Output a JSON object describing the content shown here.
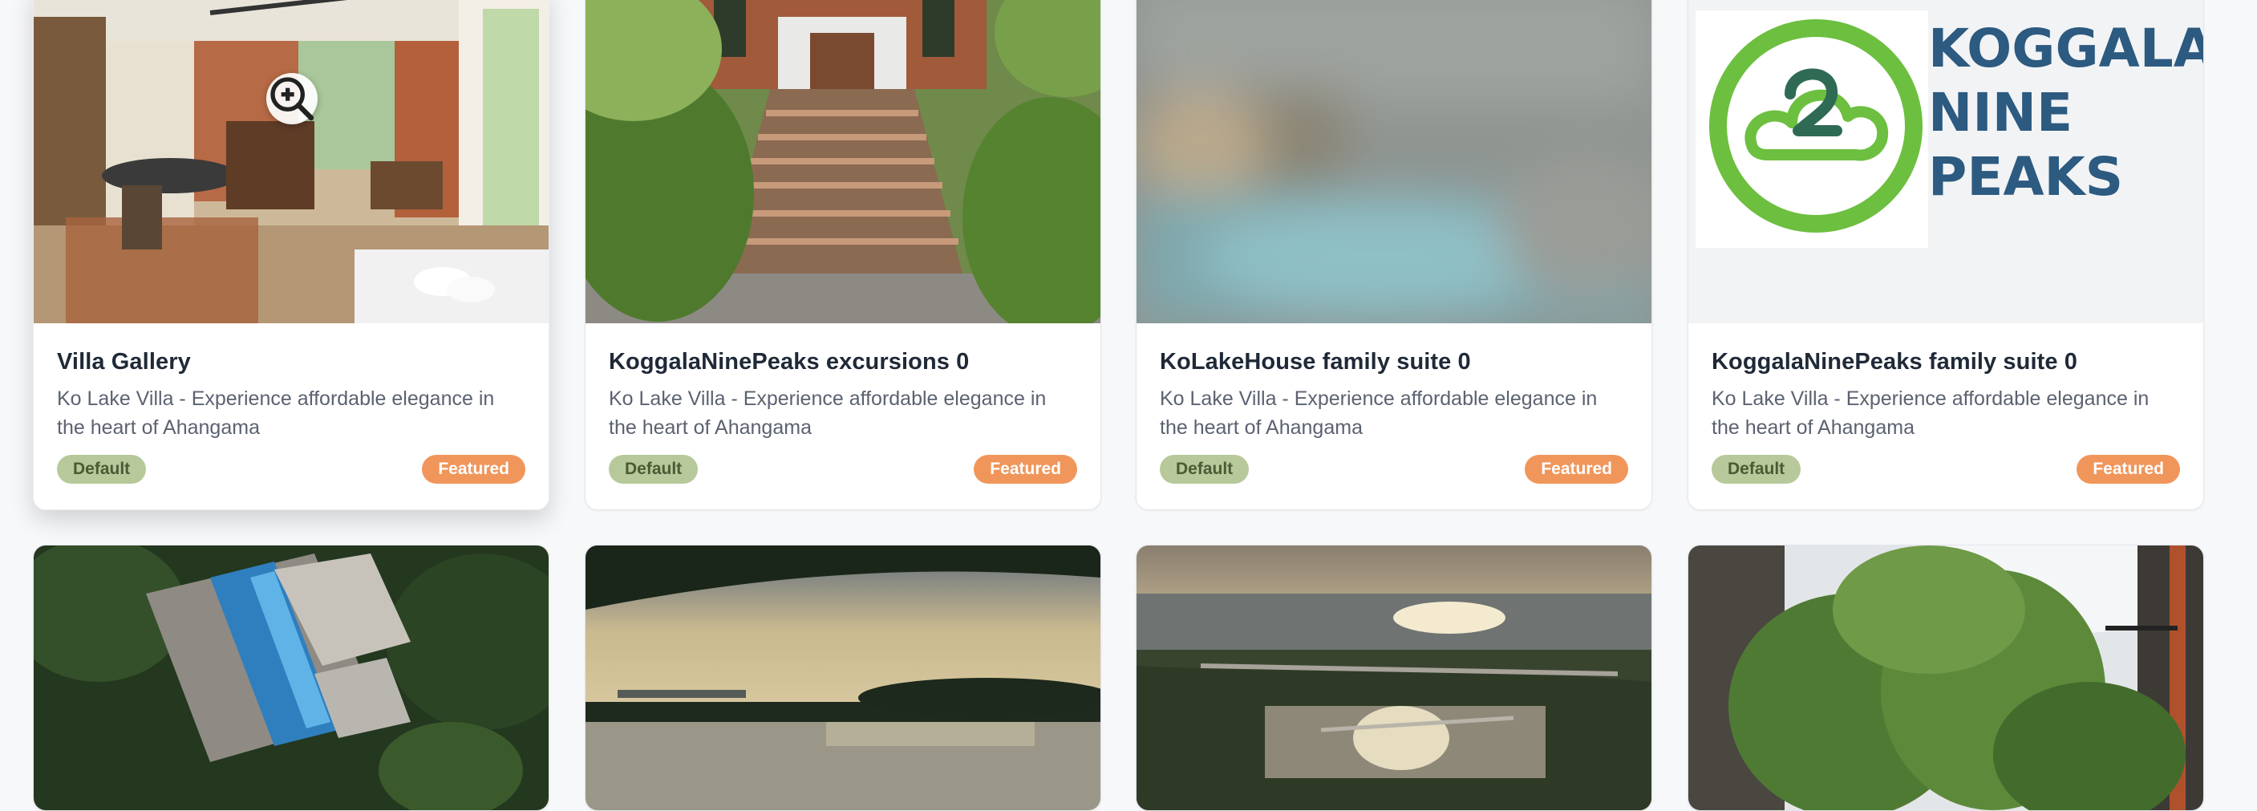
{
  "cards": [
    {
      "title": "Villa Gallery",
      "description": "Ko Lake Villa - Experience affordable elegance in the heart of Ahangama",
      "tag_default": "Default",
      "tag_featured": "Featured"
    },
    {
      "title": "KoggalaNinePeaks excursions 0",
      "description": "Ko Lake Villa - Experience affordable elegance in the heart of Ahangama",
      "tag_default": "Default",
      "tag_featured": "Featured"
    },
    {
      "title": "KoLakeHouse family suite 0",
      "description": "Ko Lake Villa - Experience affordable elegance in the heart of Ahangama",
      "tag_default": "Default",
      "tag_featured": "Featured"
    },
    {
      "title": "KoggalaNinePeaks family suite 0",
      "description": "Ko Lake Villa - Experience affordable elegance in the heart of Ahangama",
      "tag_default": "Default",
      "tag_featured": "Featured"
    }
  ],
  "logo": {
    "line1": "KOGGALA",
    "line2": "NINE",
    "line3": "PEAKS"
  },
  "icons": {
    "zoom": "zoom-in-icon"
  },
  "colors": {
    "tag_default_bg": "#b7c99a",
    "tag_featured_bg": "#f0965b",
    "logo_green": "#6cbf3f",
    "logo_blue": "#2c5a80"
  }
}
